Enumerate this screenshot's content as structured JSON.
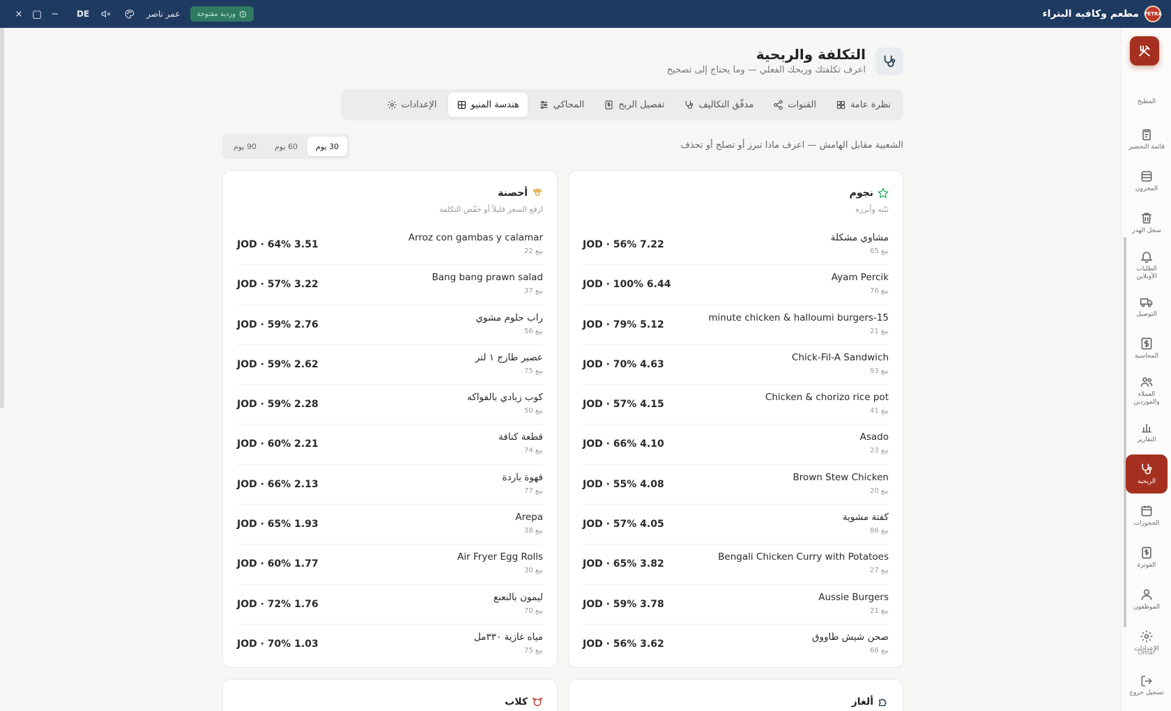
{
  "titlebar": {
    "app_title": "مطعم وكافيه البتراء",
    "logo_text": "PETRA",
    "shift_label": "وردية مفتوحة",
    "user_name": "عمر ناصر",
    "lang": "DE",
    "controls": {
      "close": "×",
      "maximize": "▢",
      "minimize": "−"
    }
  },
  "rail": {
    "items": [
      {
        "label": "المطبخ",
        "icon": "kitchen-icon"
      },
      {
        "label": "قائمة التحضير",
        "icon": "clipboard-icon"
      },
      {
        "label": "المخزون",
        "icon": "inventory-icon"
      },
      {
        "label": "سجل الهدر",
        "icon": "trash-icon"
      },
      {
        "label": "الطلبات الأونلاين",
        "icon": "bell-icon"
      },
      {
        "label": "التوصيل",
        "icon": "truck-icon"
      },
      {
        "label": "المحاسبة",
        "icon": "dollar-icon"
      },
      {
        "label": "العملاء والموردين",
        "icon": "users-icon"
      },
      {
        "label": "التقارير",
        "icon": "bar-chart-icon"
      },
      {
        "label": "الربحية",
        "icon": "stethoscope-icon"
      },
      {
        "label": "الحجوزات",
        "icon": "calendar-icon"
      },
      {
        "label": "الفوترة",
        "icon": "invoice-icon"
      },
      {
        "label": "الموظفون",
        "icon": "user-icon"
      },
      {
        "label": "الإعدادات",
        "icon": "gear-icon"
      }
    ],
    "active_index": 9,
    "user_label": "Omar",
    "logout_label": "تسجيل خروج"
  },
  "header": {
    "title": "التكلفة والربحية",
    "subtitle": "اعرف تكلفتك وربحك الفعلي — وما يحتاج إلى تصحيح"
  },
  "tabs": [
    {
      "label": "نظرة عامة",
      "icon": "grid-icon"
    },
    {
      "label": "القنوات",
      "icon": "share-icon"
    },
    {
      "label": "مدقّق التكاليف",
      "icon": "stethoscope-icon"
    },
    {
      "label": "تفصيل الربح",
      "icon": "receipt-icon"
    },
    {
      "label": "المحاكي",
      "icon": "sliders-icon"
    },
    {
      "label": "هندسة المنيو",
      "icon": "table-icon"
    },
    {
      "label": "الإعدادات",
      "icon": "gear-icon"
    }
  ],
  "active_tab": 5,
  "section": {
    "description": "الشعبية مقابل الهامش — اعرف ماذا تبرز أو تصلح أو تحذف",
    "periods": [
      "30 يوم",
      "60 يوم",
      "90 يوم"
    ],
    "active_period": 0
  },
  "cards": {
    "stars": {
      "title": "نجوم",
      "subtitle": "ثبّته وأبرزه",
      "icon": "star-icon",
      "color": "#27ae60",
      "rows": [
        {
          "name": "مشاوي مشكلة",
          "sales": "بيع 65",
          "value": "JOD · 56% 7.22"
        },
        {
          "name": "Ayam Percik",
          "sales": "بيع 76",
          "value": "JOD · 100% 6.44"
        },
        {
          "name": "minute chicken & halloumi burgers-15",
          "sales": "بيع 21",
          "value": "JOD · 79% 5.12"
        },
        {
          "name": "Chick-Fil-A Sandwich",
          "sales": "بيع 93",
          "value": "JOD · 70% 4.63"
        },
        {
          "name": "Chicken & chorizo rice pot",
          "sales": "بيع 41",
          "value": "JOD · 57% 4.15"
        },
        {
          "name": "Asado",
          "sales": "بيع 23",
          "value": "JOD · 66% 4.10"
        },
        {
          "name": "Brown Stew Chicken",
          "sales": "بيع 20",
          "value": "JOD · 55% 4.08"
        },
        {
          "name": "كفتة مشوية",
          "sales": "بيع 86",
          "value": "JOD · 57% 4.05"
        },
        {
          "name": "Bengali Chicken Curry with Potatoes",
          "sales": "بيع 27",
          "value": "JOD · 65% 3.82"
        },
        {
          "name": "Aussie Burgers",
          "sales": "بيع 21",
          "value": "JOD · 59% 3.78"
        },
        {
          "name": "صحن شيش طاووق",
          "sales": "بيع 66",
          "value": "JOD · 56% 3.62"
        }
      ]
    },
    "horses": {
      "title": "أحصنة",
      "subtitle": "ارفع السعر قليلاً أو خفّض التكلفة",
      "icon": "horse-icon",
      "color": "#e0a020",
      "rows": [
        {
          "name": "Arroz con gambas y calamar",
          "sales": "بيع 22",
          "value": "JOD · 64% 3.51"
        },
        {
          "name": "Bang bang prawn salad",
          "sales": "بيع 37",
          "value": "JOD · 57% 3.22"
        },
        {
          "name": "راب حلوم مشوي",
          "sales": "بيع 56",
          "value": "JOD · 59% 2.76"
        },
        {
          "name": "عصير طازج ١ لتر",
          "sales": "بيع 75",
          "value": "JOD · 59% 2.62"
        },
        {
          "name": "كوب زبادي بالفواكه",
          "sales": "بيع 50",
          "value": "JOD · 59% 2.28"
        },
        {
          "name": "قطعة كنافة",
          "sales": "بيع 74",
          "value": "JOD · 60% 2.21"
        },
        {
          "name": "قهوة باردة",
          "sales": "بيع 77",
          "value": "JOD · 66% 2.13"
        },
        {
          "name": "Arepa",
          "sales": "بيع 38",
          "value": "JOD · 65% 1.93"
        },
        {
          "name": "Air Fryer Egg Rolls",
          "sales": "بيع 30",
          "value": "JOD · 60% 1.77"
        },
        {
          "name": "ليمون بالنعنع",
          "sales": "بيع 70",
          "value": "JOD · 72% 1.76"
        },
        {
          "name": "مياه غازية ٣٣٠مل",
          "sales": "بيع 75",
          "value": "JOD · 70% 1.03"
        }
      ]
    },
    "puzzles": {
      "title": "ألغاز",
      "icon": "puzzle-icon",
      "color": "#2c3e50"
    },
    "dogs": {
      "title": "كلاب",
      "icon": "dog-icon",
      "color": "#c0392b"
    }
  }
}
